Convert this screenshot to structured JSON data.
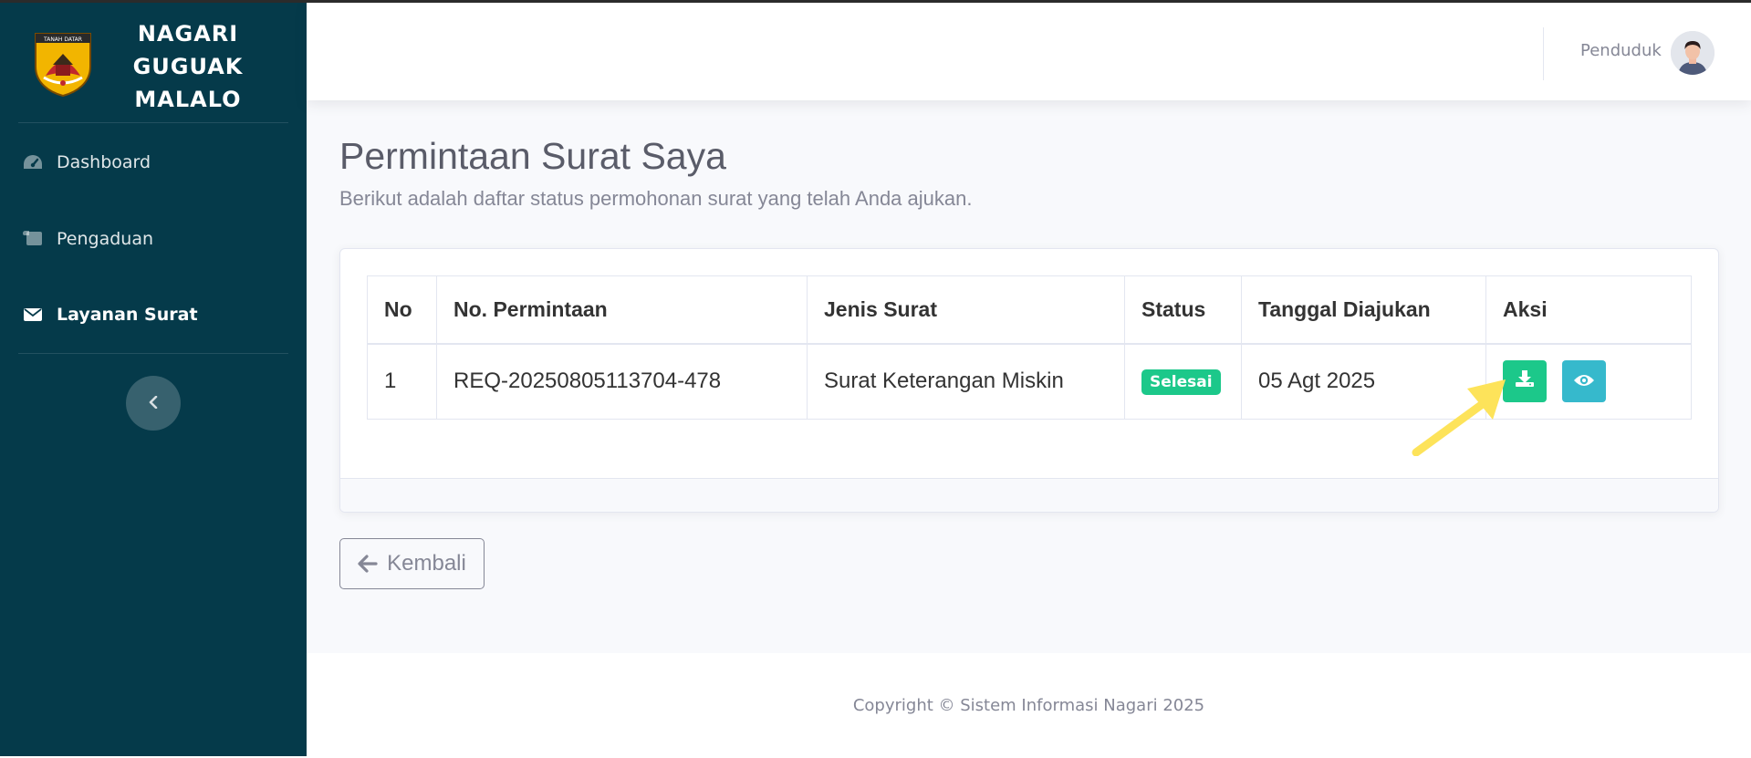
{
  "sidebar": {
    "brand_lines": [
      "NAGARI",
      "GUGUAK",
      "MALALO"
    ],
    "logo_text": "TANAH DATAR",
    "items": [
      {
        "label": "Dashboard",
        "icon": "tachometer-icon",
        "active": false
      },
      {
        "label": "Pengaduan",
        "icon": "scroll-icon",
        "active": false
      },
      {
        "label": "Layanan Surat",
        "icon": "envelope-icon",
        "active": true
      }
    ],
    "collapse_icon": "chevron-left-icon",
    "background": "#053a4a"
  },
  "topbar": {
    "user_name": "Penduduk",
    "avatar_icon": "user-avatar"
  },
  "page": {
    "title": "Permintaan Surat Saya",
    "subtitle": "Berikut adalah daftar status permohonan surat yang telah Anda ajukan."
  },
  "table": {
    "headers": [
      "No",
      "No. Permintaan",
      "Jenis Surat",
      "Status",
      "Tanggal Diajukan",
      "Aksi"
    ],
    "rows": [
      {
        "no": "1",
        "request_no": "REQ-20250805113704-478",
        "type": "Surat Keterangan Miskin",
        "status": "Selesai",
        "date": "05 Agt 2025",
        "actions": [
          "download-icon",
          "eye-icon"
        ]
      }
    ]
  },
  "colors": {
    "success": "#1cc88a",
    "info": "#36b9cc",
    "annotation_arrow": "#fde35a",
    "muted_text": "#858796"
  },
  "back_button": {
    "label": "Kembali",
    "icon": "arrow-left-icon"
  },
  "footer": {
    "copyright": "Copyright © Sistem Informasi Nagari 2025"
  }
}
